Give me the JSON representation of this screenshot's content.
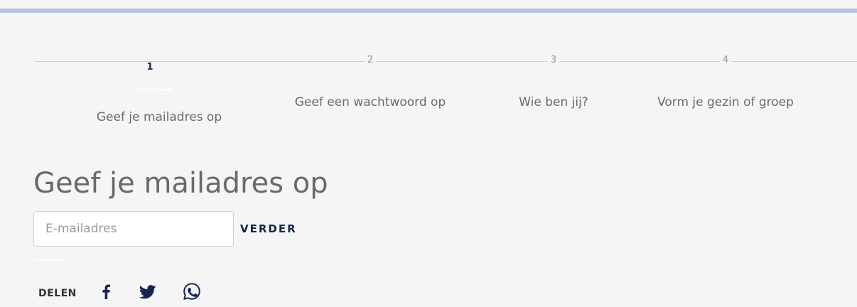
{
  "steps": [
    {
      "number": "1",
      "label": "Geef je mailadres op",
      "active": true
    },
    {
      "number": "2",
      "label": "Geef een wachtwoord op",
      "active": false
    },
    {
      "number": "3",
      "label": "Wie ben jij?",
      "active": false
    },
    {
      "number": "4",
      "label": "Vorm je gezin of groep",
      "active": false
    }
  ],
  "main": {
    "title": "Geef je mailadres op",
    "email_placeholder": "E-mailadres",
    "email_value": "",
    "submit_label": "VERDER"
  },
  "share": {
    "label": "DELEN",
    "icons": [
      "facebook-icon",
      "twitter-icon",
      "whatsapp-icon"
    ]
  },
  "colors": {
    "accent_bar": "#b8c2dc",
    "primary_dark": "#16254f",
    "text_gray": "#6a6a6a",
    "muted_gray": "#9a9a9a",
    "background": "#f5f5f5"
  }
}
